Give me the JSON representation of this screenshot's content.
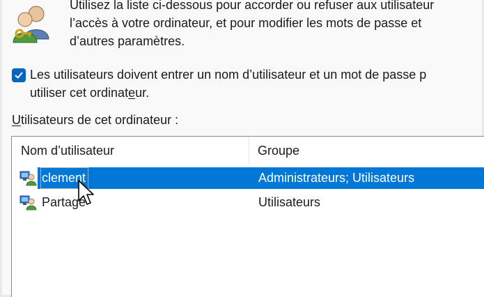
{
  "intro": {
    "text": "Utilisez la liste ci-dessous pour accorder ou refuser aux utilisateur\nl’accès à votre ordinateur, et pour modifier les mots de passe et\nd’autres paramètres.",
    "icon": "users-icon"
  },
  "require_password": {
    "checked": true,
    "label_line1": "Les utilisateurs doivent entrer un nom d’utilisateur et un mot de passe p",
    "label_line2_before": "utiliser cet ordinat",
    "label_line2_mnemonic": "e",
    "label_line2_after": "ur."
  },
  "users_section": {
    "label_mnemonic": "U",
    "label_rest": "tilisateurs de cet ordinateur :"
  },
  "users_list": {
    "columns": [
      "Nom d’utilisateur",
      "Groupe"
    ],
    "rows": [
      {
        "name": "clement",
        "group": "Administrateurs; Utilisateurs",
        "selected": true,
        "icon": "user-account-icon"
      },
      {
        "name": "Partage",
        "group": "Utilisateurs",
        "selected": false,
        "icon": "user-account-icon"
      }
    ]
  },
  "colors": {
    "accent": "#0067c0",
    "selection": "#0078d7"
  }
}
